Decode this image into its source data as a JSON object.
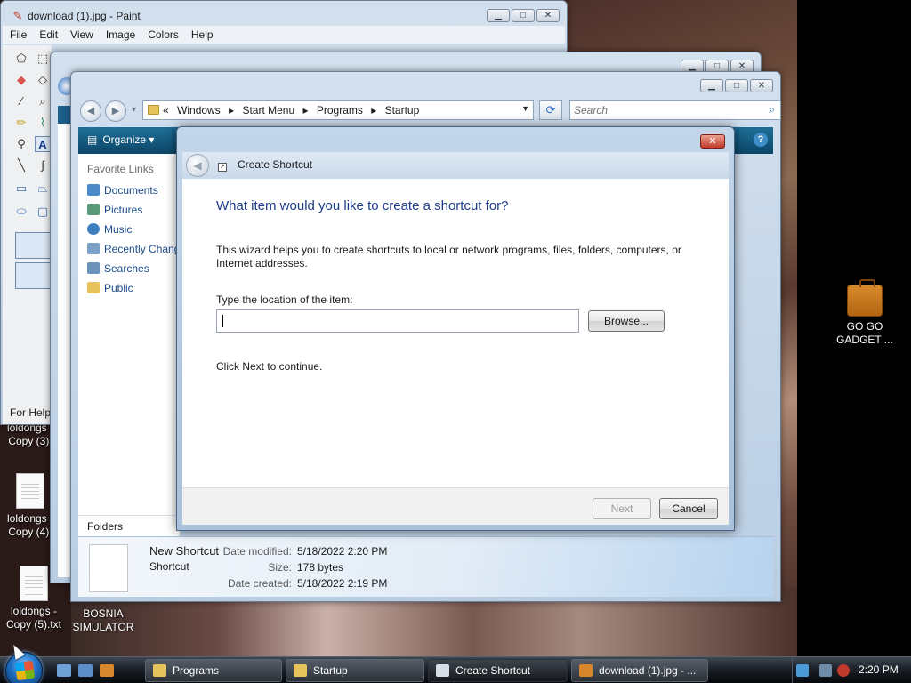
{
  "paint": {
    "title": "download (1).jpg - Paint",
    "menu": [
      "File",
      "Edit",
      "View",
      "Image",
      "Colors",
      "Help"
    ],
    "status": "For Help"
  },
  "explorer": {
    "address": [
      "«",
      "Windows",
      "Start Menu",
      "Programs",
      "Startup"
    ],
    "search_placeholder": "Search",
    "organize_label": "Organize",
    "favorite_links_label": "Favorite Links",
    "favorite_links": [
      "Documents",
      "Pictures",
      "Music",
      "Recently Chang",
      "Searches",
      "Public"
    ],
    "folders_label": "Folders",
    "details": {
      "name": "New Shortcut",
      "type": "Shortcut",
      "date_modified_label": "Date modified:",
      "date_modified": "5/18/2022 2:20 PM",
      "size_label": "Size:",
      "size": "178 bytes",
      "date_created_label": "Date created:",
      "date_created": "5/18/2022 2:19 PM"
    }
  },
  "dialog": {
    "title": "Create Shortcut",
    "instruction": "What item would you like to create a shortcut for?",
    "description": "This wizard helps you to create shortcuts to local or network programs, files, folders, computers, or Internet addresses.",
    "location_label": "Type the location of the item:",
    "location_value": "",
    "browse_label": "Browse...",
    "continue_text": "Click Next to continue.",
    "next_label": "Next",
    "cancel_label": "Cancel"
  },
  "desktop": {
    "icons": [
      {
        "label_line1": "loldongs -",
        "label_line2": "Copy (3)."
      },
      {
        "label_line1": "loldongs -",
        "label_line2": "Copy (4)."
      },
      {
        "label_line1": "loldongs -",
        "label_line2": "Copy (5).txt"
      },
      {
        "label_line1": "BOSNIA",
        "label_line2": "SIMULATOR"
      },
      {
        "label_line1": "GO GO",
        "label_line2": "GADGET ..."
      }
    ]
  },
  "taskbar": {
    "buttons": [
      "Programs",
      "Startup",
      "Create Shortcut",
      "download (1).jpg - ..."
    ],
    "active_button": "Create Shortcut",
    "clock": "2:20 PM"
  }
}
